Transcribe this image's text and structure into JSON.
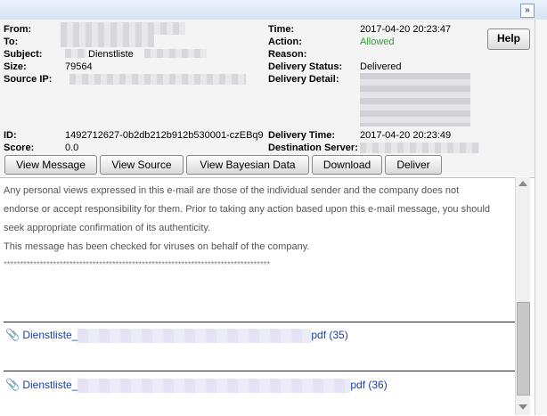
{
  "topbar": {
    "collapse_icon": "»"
  },
  "details": {
    "from_label": "From:",
    "to_label": "To:",
    "subject_label": "Subject:",
    "subject_value": "Dienstliste",
    "size_label": "Size:",
    "size_value": "79564",
    "source_ip_label": "Source IP:",
    "id_label": "ID:",
    "id_value": "1492712627-0b2db212b912b530001-czEBq9",
    "score_label": "Score:",
    "score_value": "0.0",
    "time_label": "Time:",
    "time_value": "2017-04-20 20:23:47",
    "action_label": "Action:",
    "action_value": "Allowed",
    "reason_label": "Reason:",
    "delivery_status_label": "Delivery Status:",
    "delivery_status_value": "Delivered",
    "delivery_detail_label": "Delivery Detail:",
    "delivery_time_label": "Delivery Time:",
    "delivery_time_value": "2017-04-20 20:23:49",
    "destination_server_label": "Destination Server:",
    "help_label": "Help",
    "allowed_color": "#2aa12a"
  },
  "actions": {
    "view_message": "View Message",
    "view_source": "View Source",
    "view_bayesian": "View Bayesian Data",
    "download": "Download",
    "deliver": "Deliver"
  },
  "message": {
    "line1": "Any personal views expressed in this e-mail are those of the individual sender and the company does not",
    "line2": "endorse or accept responsibility for them. Prior to taking any action based upon this e-mail message, you should",
    "line3": "seek appropriate confirmation of its authenticity.",
    "line4": "This message has been checked for viruses on behalf of the company.",
    "stars": "*********************************************************************************"
  },
  "attachments": [
    {
      "prefix": "Dienstliste_",
      "suffix": "pdf (35)"
    },
    {
      "prefix": "Dienstliste_",
      "suffix": "pdf (36)"
    }
  ]
}
